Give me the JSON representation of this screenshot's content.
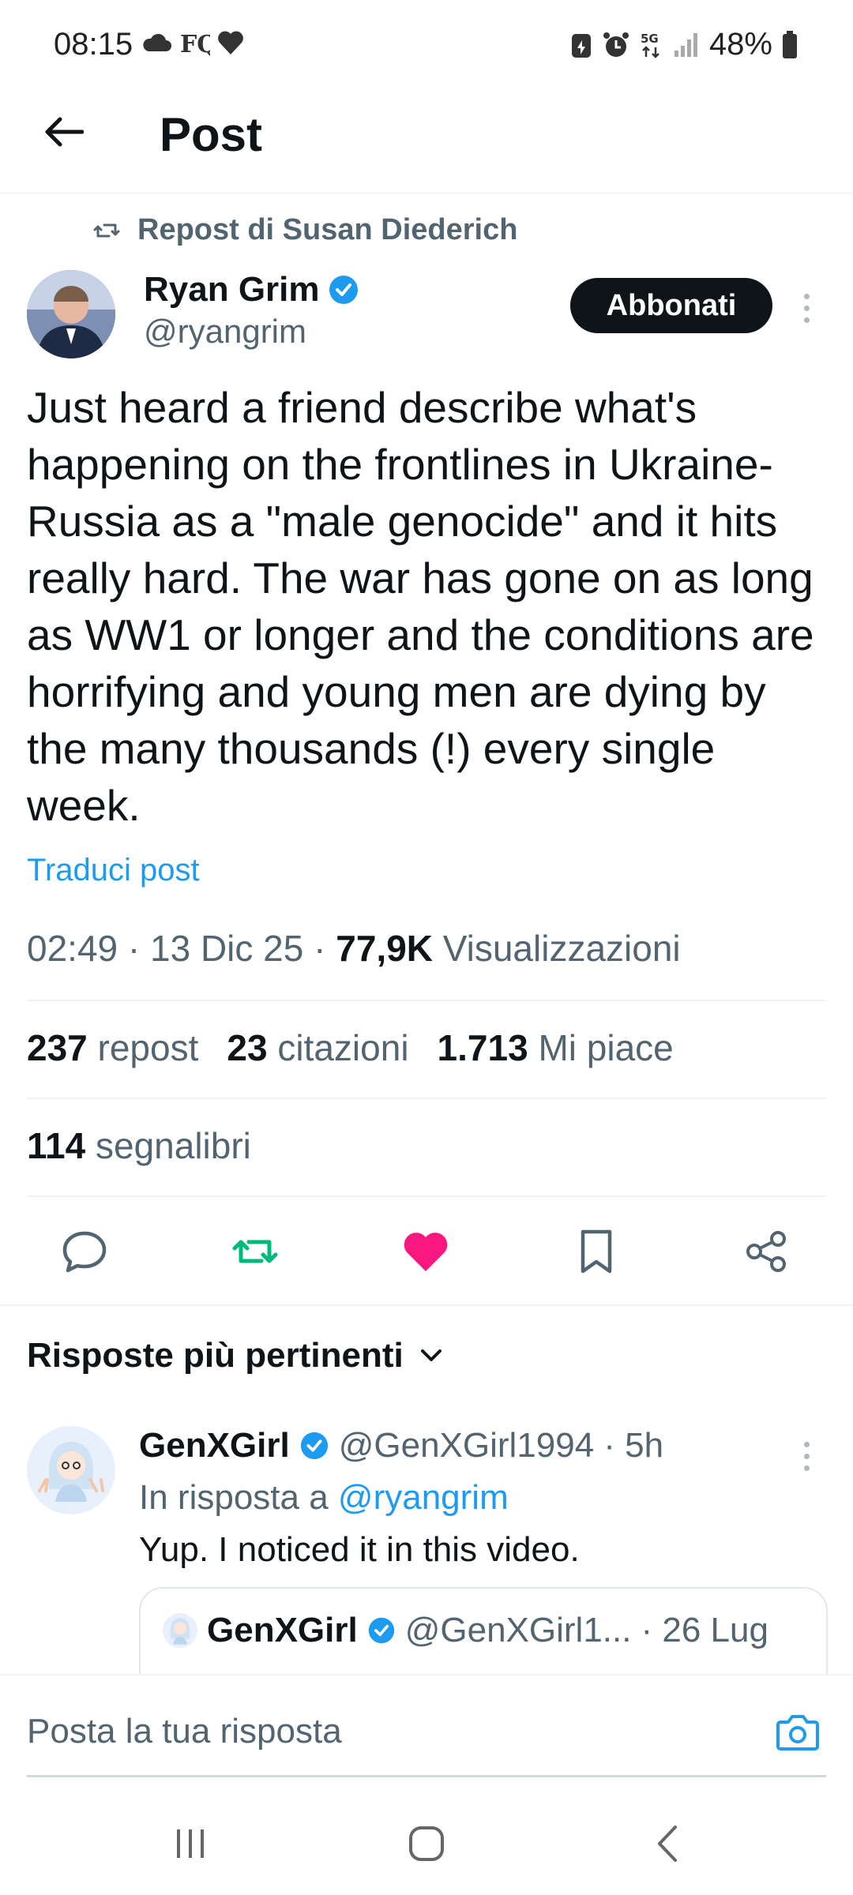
{
  "status_bar": {
    "time": "08:15",
    "battery": "48%",
    "network": "5G",
    "left_icons": [
      "cloud-icon",
      "news-icon",
      "heart-icon"
    ],
    "right_icons": [
      "battery-saver-icon",
      "alarm-icon",
      "network-5g-icon",
      "signal-icon",
      "battery-icon"
    ]
  },
  "header": {
    "title": "Post"
  },
  "post": {
    "repost_label": "Repost di Susan Diederich",
    "author_name": "Ryan Grim",
    "author_handle": "@ryangrim",
    "subscribe_label": "Abbonati",
    "text": "Just heard a friend describe what's happening on the frontlines in Ukraine-Russia as a \"male genocide\" and it hits really hard. The war has gone on as long as WW1 or longer and the conditions are horrifying and young men are dying by the many thousands (!) every single week.",
    "translate_label": "Traduci post",
    "time": "02:49",
    "date": "13 Dic 25",
    "views_count": "77,9K",
    "views_label": "Visualizzazioni",
    "separator": "·"
  },
  "stats": {
    "reposts_count": "237",
    "reposts_label": "repost",
    "quotes_count": "23",
    "quotes_label": "citazioni",
    "likes_count": "1.713",
    "likes_label": "Mi piace",
    "bookmarks_count": "114",
    "bookmarks_label": "segnalibri"
  },
  "actions": {
    "reply_icon": "reply-icon",
    "repost_icon": "repost-icon",
    "like_icon": "heart-filled-icon",
    "bookmark_icon": "bookmark-icon",
    "share_icon": "share-icon",
    "repost_color": "#00ba7c",
    "like_color": "#f91880"
  },
  "replies": {
    "sort_label": "Risposte più pertinenti",
    "items": [
      {
        "name": "GenXGirl",
        "handle": "@GenXGirl1994",
        "time": "· 5h",
        "reply_to_prefix": "In risposta a",
        "reply_to_handle": "@ryangrim",
        "text": "Yup. I noticed it in this video.",
        "quote": {
          "name": "GenXGirl",
          "handle": "@GenXGirl1...",
          "date": "· 26 Lug"
        }
      }
    ]
  },
  "compose": {
    "placeholder": "Posta la tua risposta"
  },
  "colors": {
    "accent": "#1d9bf0",
    "text": "#0f1419",
    "muted": "#536471"
  }
}
